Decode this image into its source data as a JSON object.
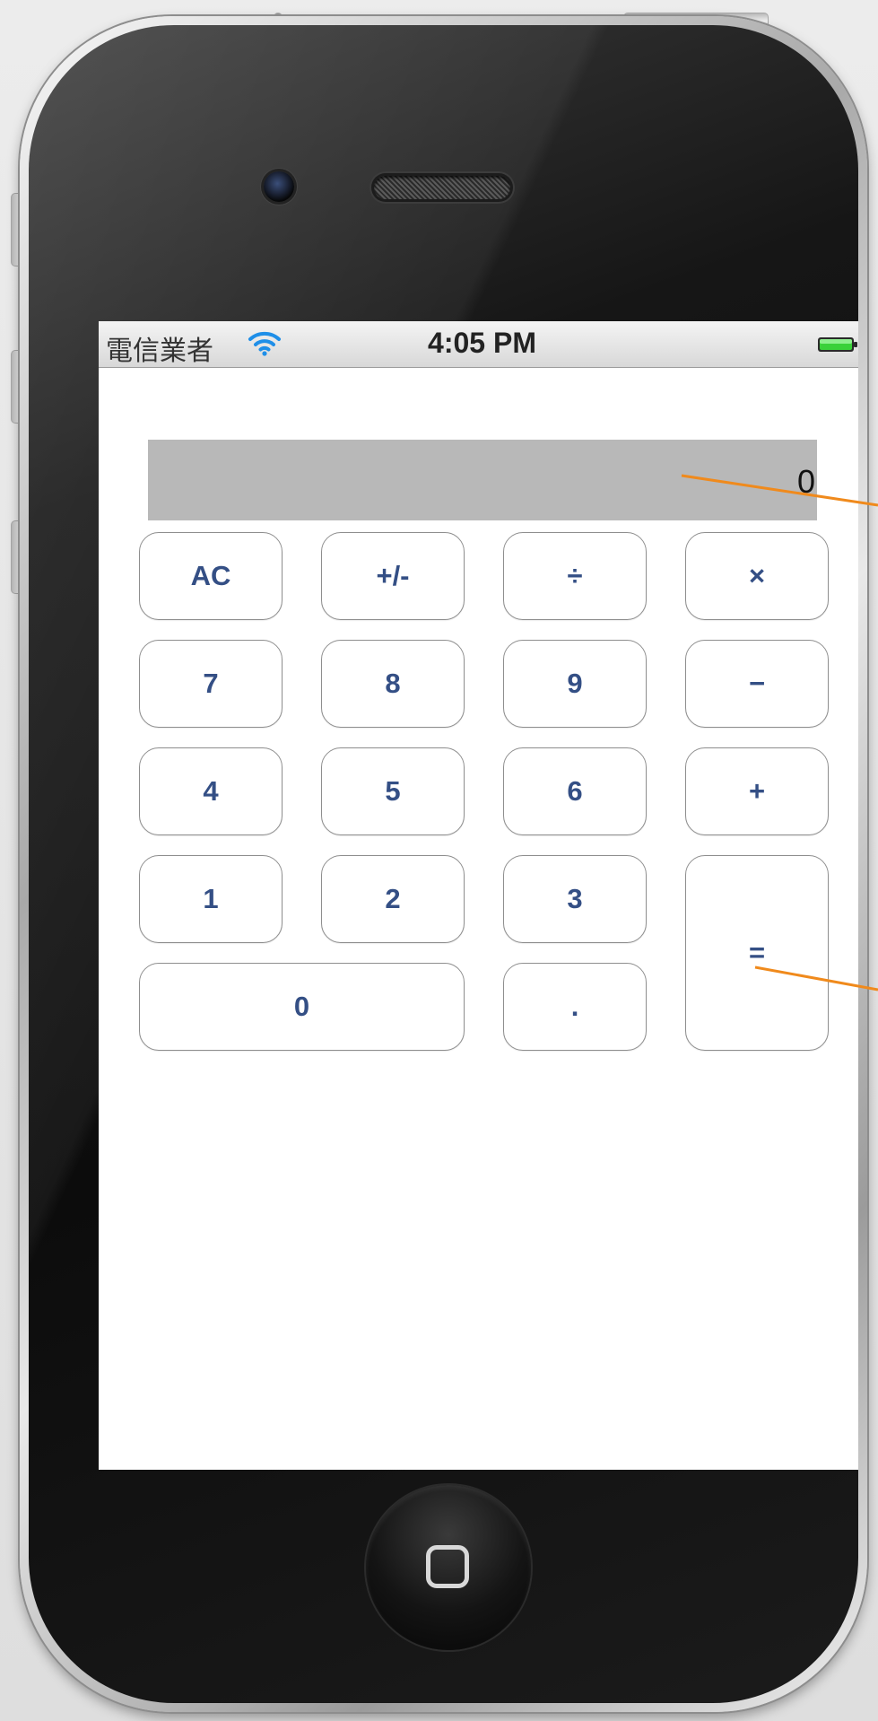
{
  "status_bar": {
    "carrier": "電信業者",
    "time": "4:05 PM"
  },
  "display": {
    "value": "0"
  },
  "keys": {
    "ac": "AC",
    "plus_minus": "+/-",
    "divide": "÷",
    "multiply": "×",
    "seven": "7",
    "eight": "8",
    "nine": "9",
    "minus": "−",
    "four": "4",
    "five": "5",
    "six": "6",
    "plus": "+",
    "one": "1",
    "two": "2",
    "three": "3",
    "equals": "=",
    "zero": "0",
    "decimal": "."
  },
  "icons": {
    "wifi": "wifi-icon",
    "battery": "battery-icon",
    "home": "home-button-icon"
  },
  "colors": {
    "key_text": "#344f85",
    "display_bg": "#b8b8b8",
    "annotation": "#f08a1c",
    "battery_fill": "#3ad13a",
    "wifi": "#1f8fe8"
  }
}
